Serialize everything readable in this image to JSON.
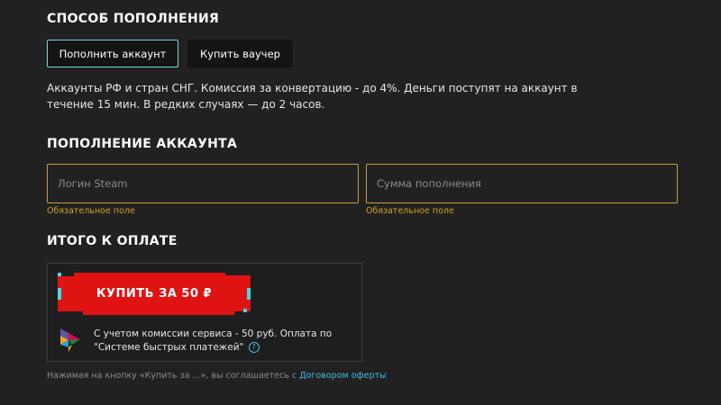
{
  "method": {
    "title": "СПОСОБ ПОПОЛНЕНИЯ",
    "options": [
      {
        "label": "Пополнить аккаунт",
        "active": true
      },
      {
        "label": "Купить ваучер",
        "active": false
      }
    ],
    "description": "Аккаунты РФ и стран СНГ. Комиссия за конвертацию - до 4%. Деньги поступят на аккаунт в течение 15 мин. В редких случаях — до 2 часов."
  },
  "topup": {
    "title": "ПОПОЛНЕНИЕ АККАУНТА",
    "login_placeholder": "Логин Steam",
    "login_value": "",
    "amount_placeholder": "Сумма пополнения",
    "amount_value": "",
    "required_hint": "Обязательное поле"
  },
  "total": {
    "title": "ИТОГО К ОПЛАТЕ",
    "buy_label": "КУПИТЬ ЗА 50 ₽",
    "commission_text": "С учетом комиссии сервиса - 50 руб. Оплата по \"Системе быстрых платежей\"",
    "agreement_prefix": "Нажимая на кнопку «Купить за ...», вы соглашаетесь с ",
    "agreement_link": "Договором оферты"
  },
  "icons": {
    "payment": "sbp-logo-icon",
    "help": "question-circle-icon"
  },
  "colors": {
    "background": "#212121",
    "active_border": "#7fd3df",
    "field_border": "#c5a03c",
    "hint": "#d4a017",
    "buy_button": "#e01313",
    "button_accent": "#43d9e8",
    "link": "#43b9e0"
  }
}
